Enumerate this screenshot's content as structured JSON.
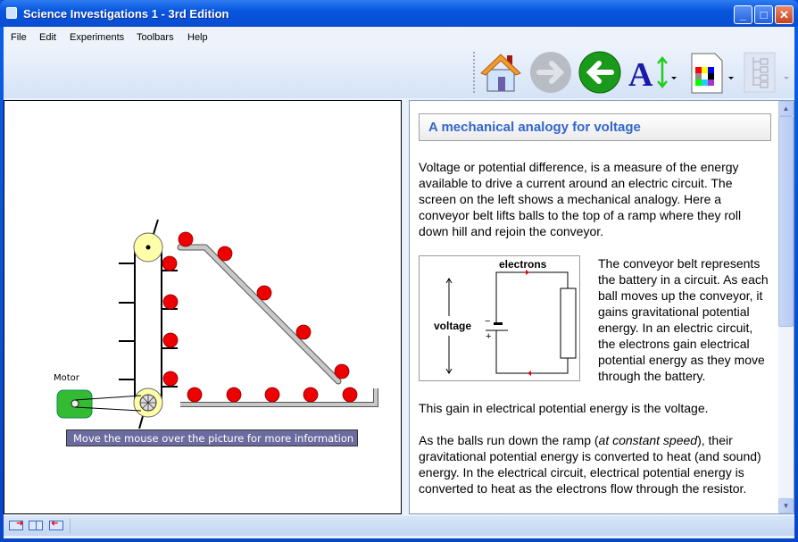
{
  "window": {
    "title": "Science Investigations 1 - 3rd Edition",
    "buttons": [
      "minimize",
      "maximize",
      "close"
    ]
  },
  "menu": [
    "File",
    "Edit",
    "Experiments",
    "Toolbars",
    "Help"
  ],
  "toolbar": {
    "icons": [
      "home-icon",
      "forward-arrow-icon (disabled)",
      "back-arrow-icon",
      "font-size-icon",
      "color-palette-icon",
      "tree-view-icon (disabled)"
    ]
  },
  "diagram": {
    "motor_label": "Motor",
    "caption": "Move the mouse over the picture for more information",
    "colors": {
      "ball": "#ff0000",
      "motor": "#33bb33",
      "pulley": "#ffffaa",
      "ramp": "#c0c0c0"
    }
  },
  "article": {
    "heading": "A mechanical analogy for voltage",
    "p1": "Voltage or potential difference, is a measure of the energy available to drive a current around an electric circuit. The screen on the left shows a mechanical analogy. Here a conveyor belt lifts balls to the top of a ramp where they roll down hill and rejoin the conveyor.",
    "figure": {
      "electrons": "electrons",
      "voltage": "voltage",
      "minus": "−",
      "plus": "+"
    },
    "p2": "The conveyor belt represents the battery in a circuit. As each ball moves up the conveyor, it gains gravitational potential energy. In an electric circuit, the electrons gain electrical potential energy as they move through the battery.",
    "p3": "This gain in electrical potential energy is the voltage.",
    "p4a": "As the balls run down the ramp (",
    "p4i": "at constant speed",
    "p4b": "), their gravitational potential energy is converted to heat (and sound) energy. In the electrical circuit, electrical potential energy is converted to heat as the electrons flow through the resistor."
  }
}
